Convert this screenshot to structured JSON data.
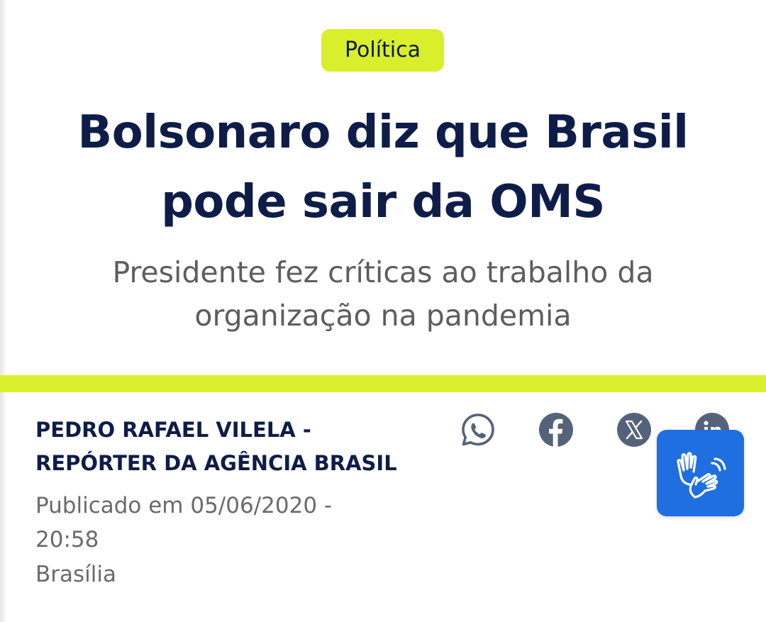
{
  "article": {
    "category": "Política",
    "headline_line1": "Bolsonaro diz que Brasil",
    "headline_line2": "pode sair da OMS",
    "subtitle_line1": "Presidente fez críticas ao trabalho da",
    "subtitle_line2": "organização na pandemia"
  },
  "byline": {
    "author_line1": "PEDRO RAFAEL VILELA -",
    "author_line2": "REPÓRTER DA AGÊNCIA BRASIL",
    "published_line1": "Publicado em 05/06/2020 -",
    "published_line2": "20:58",
    "location": "Brasília"
  },
  "share": {
    "icons": [
      "whatsapp-icon",
      "facebook-icon",
      "x-twitter-icon",
      "linkedin-icon"
    ],
    "icon_color": "#55637a"
  },
  "accessibility": {
    "icon": "sign-language-icon",
    "color": "#1f6fe0"
  },
  "theme": {
    "accent": "#d9ef2c",
    "headline_color": "#0e1d48"
  }
}
